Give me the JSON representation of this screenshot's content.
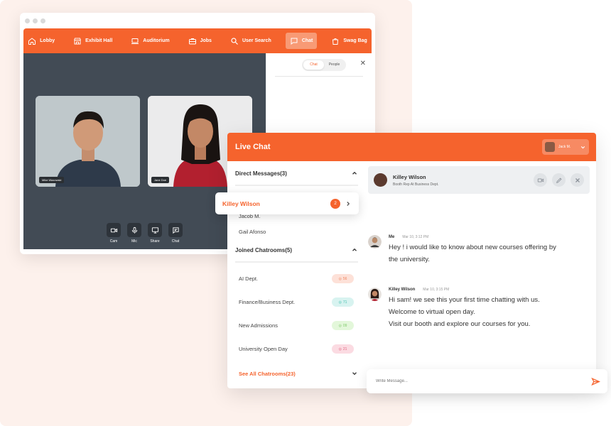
{
  "nav": {
    "items": [
      {
        "label": "Lobby",
        "icon": "home-icon"
      },
      {
        "label": "Exhibit Hall",
        "icon": "store-icon"
      },
      {
        "label": "Auditorium",
        "icon": "laptop-icon"
      },
      {
        "label": "Jobs",
        "icon": "briefcase-icon"
      },
      {
        "label": "User Search",
        "icon": "search-icon"
      },
      {
        "label": "Chat",
        "icon": "chat-icon",
        "active": true
      },
      {
        "label": "Swag Bag",
        "icon": "bag-icon"
      }
    ]
  },
  "video": {
    "participants": [
      {
        "name": "Mike Wazowski"
      },
      {
        "name": "Jane Doe"
      }
    ],
    "controls": [
      {
        "label": "Cam",
        "icon": "camera-icon"
      },
      {
        "label": "Mic",
        "icon": "mic-icon"
      },
      {
        "label": "Share",
        "icon": "screen-share-icon"
      },
      {
        "label": "Chat",
        "icon": "chat-icon"
      }
    ]
  },
  "side_panel": {
    "tabs": [
      "Chat",
      "People"
    ],
    "active_tab": "Chat",
    "close": "✕"
  },
  "live_chat": {
    "title": "Live Chat",
    "user": "Jack M.",
    "direct_messages_header": "Direct Messages(3)",
    "direct_messages": [
      {
        "name": "Killey Wilson",
        "unread": "2"
      },
      {
        "name": "Jacob M."
      },
      {
        "name": "Gail Afonso"
      }
    ],
    "joined_header": "Joined Chatrooms(5)",
    "chatrooms": [
      {
        "name": "AI Dept.",
        "count": "56",
        "color": "#fde1d8",
        "text_color": "#f0845e"
      },
      {
        "name": "Finance/Business Dept.",
        "count": "71",
        "color": "#d8f3f0",
        "text_color": "#3fbfae"
      },
      {
        "name": "New Admissions",
        "count": "09",
        "color": "#e3f7da",
        "text_color": "#7ec96a"
      },
      {
        "name": "University Open Day",
        "count": "21",
        "color": "#fbdbe2",
        "text_color": "#e2647e"
      }
    ],
    "see_all": "See All Chatrooms(23)",
    "conversation": {
      "name": "Killey Wilson",
      "subtitle": "Booth Rep At Business Dept.",
      "messages": [
        {
          "sender": "Me",
          "time": "Mar 10, 3:12 PM",
          "lines": [
            "Hey ! i would like to  know about new courses offering by",
            "the university."
          ]
        },
        {
          "sender": "Killey Wilson",
          "time": "Mar 10, 3:15 PM",
          "lines": [
            "Hi sam! we see this your first time chatting with us.",
            "Welcome to virtual open day.",
            "Visit our booth and explore our courses for you."
          ]
        }
      ]
    },
    "composer_placeholder": "Write Message..."
  },
  "colors": {
    "brand": "#f5632d"
  }
}
